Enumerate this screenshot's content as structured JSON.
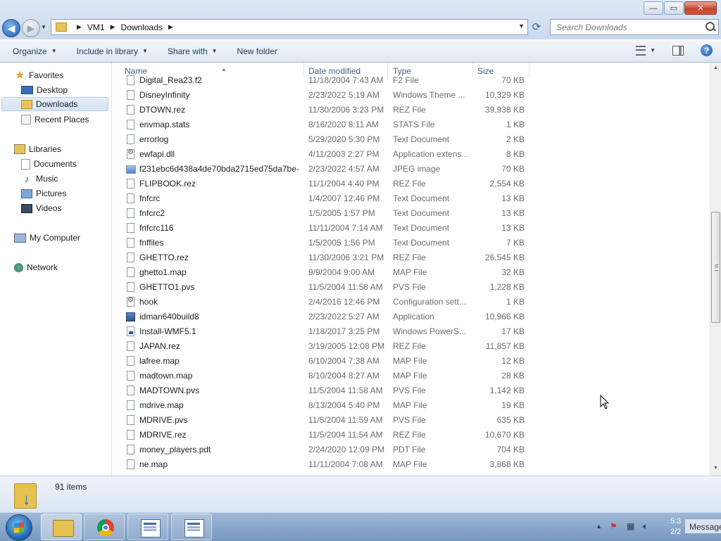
{
  "window": {
    "minimize_glyph": "—",
    "maximize_glyph": "▭",
    "close_glyph": "✕"
  },
  "address": {
    "segments": [
      "VM1",
      "Downloads"
    ],
    "separator": "▶"
  },
  "search": {
    "placeholder": "Search Downloads"
  },
  "toolbar": {
    "organize": "Organize",
    "include_in_library": "Include in library",
    "share_with": "Share with",
    "new_folder": "New folder",
    "help_glyph": "?"
  },
  "navigation": {
    "favorites": "Favorites",
    "desktop": "Desktop",
    "downloads": "Downloads",
    "recent_places": "Recent Places",
    "libraries": "Libraries",
    "documents": "Documents",
    "music": "Music",
    "pictures": "Pictures",
    "videos": "Videos",
    "my_computer": "My Computer",
    "network": "Network"
  },
  "columns": {
    "name": "Name",
    "date_modified": "Date modified",
    "type": "Type",
    "size": "Size"
  },
  "files": [
    {
      "name": "Digital_Rea23.f2",
      "date": "11/18/2004 7:43 AM",
      "type": "F2 File",
      "size": "70 KB",
      "icon": "blank"
    },
    {
      "name": "DisneyInfinity",
      "date": "2/23/2022 5:19 AM",
      "type": "Windows Theme ...",
      "size": "10,329 KB",
      "icon": "blank"
    },
    {
      "name": "DTOWN.rez",
      "date": "11/30/2006 3:23 PM",
      "type": "REZ File",
      "size": "39,938 KB",
      "icon": "blank"
    },
    {
      "name": "envmap.stats",
      "date": "8/16/2020 8:11 AM",
      "type": "STATS File",
      "size": "1 KB",
      "icon": "blank"
    },
    {
      "name": "errorlog",
      "date": "5/29/2020 5:30 PM",
      "type": "Text Document",
      "size": "2 KB",
      "icon": "blank"
    },
    {
      "name": "ewfapi.dll",
      "date": "4/11/2003 2:27 PM",
      "type": "Application extens...",
      "size": "8 KB",
      "icon": "settings"
    },
    {
      "name": "f231ebc6d438a4de70bda2715ed75da7be-...",
      "date": "2/23/2022 4:57 AM",
      "type": "JPEG image",
      "size": "70 KB",
      "icon": "image"
    },
    {
      "name": "FLIPBOOK.rez",
      "date": "11/1/2004 4:40 PM",
      "type": "REZ File",
      "size": "2,554 KB",
      "icon": "blank"
    },
    {
      "name": "fnfcrc",
      "date": "1/4/2007 12:46 PM",
      "type": "Text Document",
      "size": "13 KB",
      "icon": "blank"
    },
    {
      "name": "fnfcrc2",
      "date": "1/5/2005 1:57 PM",
      "type": "Text Document",
      "size": "13 KB",
      "icon": "blank"
    },
    {
      "name": "fnfcrc116",
      "date": "11/11/2004 7:14 AM",
      "type": "Text Document",
      "size": "13 KB",
      "icon": "blank"
    },
    {
      "name": "fnffiles",
      "date": "1/5/2005 1:56 PM",
      "type": "Text Document",
      "size": "7 KB",
      "icon": "blank"
    },
    {
      "name": "GHETTO.rez",
      "date": "11/30/2006 3:21 PM",
      "type": "REZ File",
      "size": "26,545 KB",
      "icon": "blank"
    },
    {
      "name": "ghetto1.map",
      "date": "9/9/2004 9:00 AM",
      "type": "MAP File",
      "size": "32 KB",
      "icon": "blank"
    },
    {
      "name": "GHETTO1.pvs",
      "date": "11/5/2004 11:58 AM",
      "type": "PVS File",
      "size": "1,228 KB",
      "icon": "blank"
    },
    {
      "name": "hook",
      "date": "2/4/2016 12:46 PM",
      "type": "Configuration sett...",
      "size": "1 KB",
      "icon": "settings"
    },
    {
      "name": "idman640build8",
      "date": "2/23/2022 5:27 AM",
      "type": "Application",
      "size": "10,966 KB",
      "icon": "app"
    },
    {
      "name": "Install-WMF5.1",
      "date": "1/18/2017 3:25 PM",
      "type": "Windows PowerS...",
      "size": "17 KB",
      "icon": "ps"
    },
    {
      "name": "JAPAN.rez",
      "date": "3/19/2005 12:08 PM",
      "type": "REZ File",
      "size": "11,857 KB",
      "icon": "blank"
    },
    {
      "name": "lafree.map",
      "date": "6/10/2004 7:38 AM",
      "type": "MAP File",
      "size": "12 KB",
      "icon": "blank"
    },
    {
      "name": "madtown.map",
      "date": "8/10/2004 8:27 AM",
      "type": "MAP File",
      "size": "28 KB",
      "icon": "blank"
    },
    {
      "name": "MADTOWN.pvs",
      "date": "11/5/2004 11:58 AM",
      "type": "PVS File",
      "size": "1,142 KB",
      "icon": "blank"
    },
    {
      "name": "mdrive.map",
      "date": "8/13/2004 5:40 PM",
      "type": "MAP File",
      "size": "19 KB",
      "icon": "blank"
    },
    {
      "name": "MDRIVE.pvs",
      "date": "11/5/2004 11:59 AM",
      "type": "PVS File",
      "size": "635 KB",
      "icon": "blank"
    },
    {
      "name": "MDRIVE.rez",
      "date": "11/5/2004 11:54 AM",
      "type": "REZ File",
      "size": "10,670 KB",
      "icon": "blank"
    },
    {
      "name": "money_players.pdt",
      "date": "2/24/2020 12:09 PM",
      "type": "PDT File",
      "size": "704 KB",
      "icon": "blank"
    },
    {
      "name": "ne.map",
      "date": "11/11/2004 7:08 AM",
      "type": "MAP File",
      "size": "3,868 KB",
      "icon": "blank"
    }
  ],
  "status": {
    "items_count": "91 items"
  },
  "taskbar": {
    "clock_time": "5:3",
    "clock_date": "2/2",
    "message_label": "Message"
  }
}
